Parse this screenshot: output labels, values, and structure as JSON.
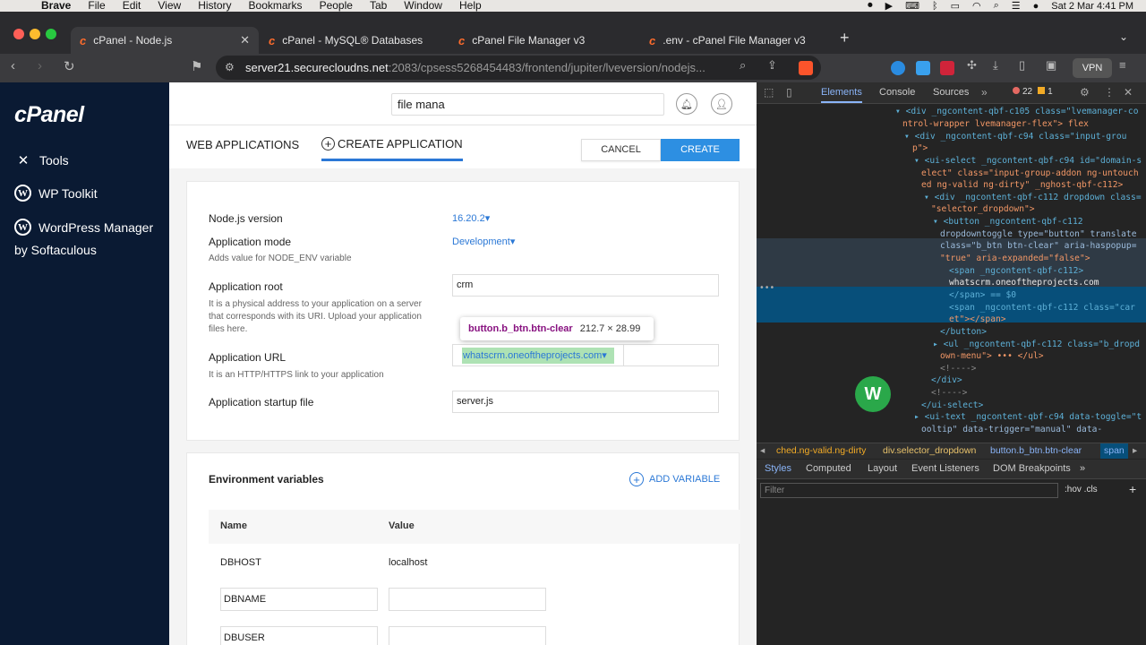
{
  "menubar": {
    "items": [
      "Brave",
      "File",
      "Edit",
      "View",
      "History",
      "Bookmarks",
      "People",
      "Tab",
      "Window",
      "Help"
    ],
    "datetime": "Sat 2 Mar  4:41 PM"
  },
  "tabs": [
    {
      "label": "cPanel - Node.js",
      "close": "✕"
    },
    {
      "label": "cPanel - MySQL® Databases"
    },
    {
      "label": "cPanel File Manager v3"
    },
    {
      "label": ".env - cPanel File Manager v3"
    }
  ],
  "address": {
    "host": "server21.securecloudns.net",
    "path": ":2083/cpsess5268454483/frontend/jupiter/lveversion/nodejs...",
    "vpn": "VPN"
  },
  "sidebar": {
    "logo": "cPanel",
    "items": [
      {
        "label": "Tools"
      },
      {
        "label": "WP Toolkit"
      },
      {
        "label": "WordPress Manager"
      },
      {
        "label": "by Softaculous"
      }
    ]
  },
  "topbar": {
    "search_value": "file mana"
  },
  "page": {
    "tab_web": "WEB APPLICATIONS",
    "tab_create": "CREATE APPLICATION",
    "cancel": "CANCEL",
    "create": "CREATE"
  },
  "form": {
    "node_label": "Node.js version",
    "node_value": "16.20.2",
    "mode_label": "Application mode",
    "mode_value": "Development",
    "mode_hint": "Adds value for NODE_ENV variable",
    "root_label": "Application root",
    "root_value": "crm",
    "root_hint": "It is a physical address to your application on a server that corresponds with its URI. Upload your application files here.",
    "url_label": "Application URL",
    "url_value": "whatscrm.oneoftheprojects.com",
    "url_hint": "It is an HTTP/HTTPS link to your application",
    "startup_label": "Application startup file",
    "startup_value": "server.js"
  },
  "tooltip": {
    "selector": "button.b_btn.btn-clear",
    "dims": "212.7 × 28.99"
  },
  "env": {
    "title": "Environment variables",
    "add": "ADD VARIABLE",
    "col_name": "Name",
    "col_value": "Value",
    "rows": [
      {
        "name": "DBHOST",
        "value": "localhost"
      },
      {
        "name": "DBNAME",
        "value": ""
      },
      {
        "name": "DBUSER",
        "value": ""
      }
    ]
  },
  "devtools": {
    "tabs": [
      "Elements",
      "Console",
      "Sources"
    ],
    "errors": "22",
    "warnings": "1",
    "dom": [
      "<div _ngcontent-qbf-c105 class=\"lvemanager-co",
      "ntrol-wrapper lvemanager-flex\"> flex",
      "<div _ngcontent-qbf-c94 class=\"input-grou",
      "p\">",
      "<ui-select _ngcontent-qbf-c94 id=\"domain-s",
      "elect\" class=\"input-group-addon ng-untouch",
      "ed ng-valid ng-dirty\" _nghost-qbf-c112>",
      "<div _ngcontent-qbf-c112 dropdown class=",
      "\"selector_dropdown\">",
      "<button _ngcontent-qbf-c112",
      "dropdowntoggle type=\"button\" translate",
      "class=\"b_btn btn-clear\" aria-haspopup=",
      "\"true\" aria-expanded=\"false\">",
      "<span _ngcontent-qbf-c112>",
      "whatscrm.oneoftheprojects.com",
      "</span> == $0",
      "<span _ngcontent-qbf-c112 class=\"car",
      "et\"></span>",
      "</button>",
      "<ul _ngcontent-qbf-c112 class=\"b_dropd",
      "own-menu\"> ••• </ul>",
      "<!---->",
      "</div>",
      "<!---->",
      "</ui-select>",
      "<ui-text _ngcontent-qbf-c94 data-toggle=\"t",
      "ooltip\" data-trigger=\"manual\" data-"
    ],
    "breadcrumbs": [
      "ched.ng-valid.ng-dirty",
      "div.selector_dropdown",
      "button.b_btn.btn-clear",
      "span"
    ],
    "subtabs": [
      "Styles",
      "Computed",
      "Layout",
      "Event Listeners",
      "DOM Breakpoints"
    ],
    "filter_placeholder": "Filter",
    "filter_right": ":hov  .cls"
  },
  "colors": {
    "cpanel_sidebar": "#0a1a33",
    "accent": "#2b78d6",
    "create_btn": "#2d8fe2"
  }
}
